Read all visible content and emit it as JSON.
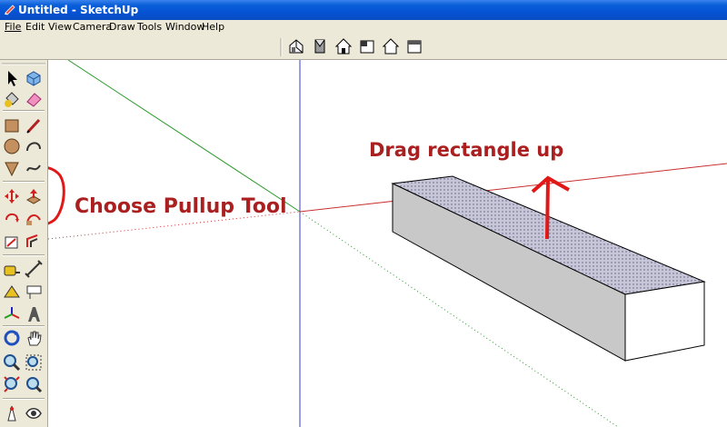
{
  "window": {
    "title": "Untitled - SketchUp"
  },
  "menu": [
    {
      "label": "File"
    },
    {
      "label": "Edit"
    },
    {
      "label": "View"
    },
    {
      "label": "Camera"
    },
    {
      "label": "Draw"
    },
    {
      "label": "Tools"
    },
    {
      "label": "Window"
    },
    {
      "label": "Help"
    }
  ],
  "views_toolbar": [
    {
      "icon": "iso-view-icon"
    },
    {
      "icon": "top-view-icon"
    },
    {
      "icon": "front-view-icon"
    },
    {
      "icon": "right-view-icon"
    },
    {
      "icon": "back-view-icon"
    },
    {
      "icon": "left-view-icon"
    }
  ],
  "tools": [
    "select-tool-icon",
    "component-tool-icon",
    "paint-bucket-tool-icon",
    "eraser-tool-icon",
    "rectangle-tool-icon",
    "line-tool-icon",
    "circle-tool-icon",
    "arc-tool-icon",
    "polygon-tool-icon",
    "freehand-tool-icon",
    "move-tool-icon",
    "pushpull-tool-icon",
    "rotate-tool-icon",
    "follow-me-tool-icon",
    "scale-tool-icon",
    "offset-tool-icon",
    "tape-measure-tool-icon",
    "dimension-tool-icon",
    "protractor-tool-icon",
    "text-tool-icon",
    "axes-tool-icon",
    "3d-text-tool-icon",
    "orbit-tool-icon",
    "pan-tool-icon",
    "zoom-tool-icon",
    "zoom-window-tool-icon",
    "zoom-extents-tool-icon",
    "previous-view-icon",
    "position-camera-tool-icon",
    "look-around-tool-icon"
  ],
  "annotations": {
    "pullup_label": "Choose Pullup Tool",
    "drag_label": "Drag rectangle up"
  },
  "colors": {
    "annotation": "#aa1f1f",
    "red_axis": "#c83030",
    "green_axis": "#2a9a2a",
    "blue_axis": "#3838d8"
  }
}
